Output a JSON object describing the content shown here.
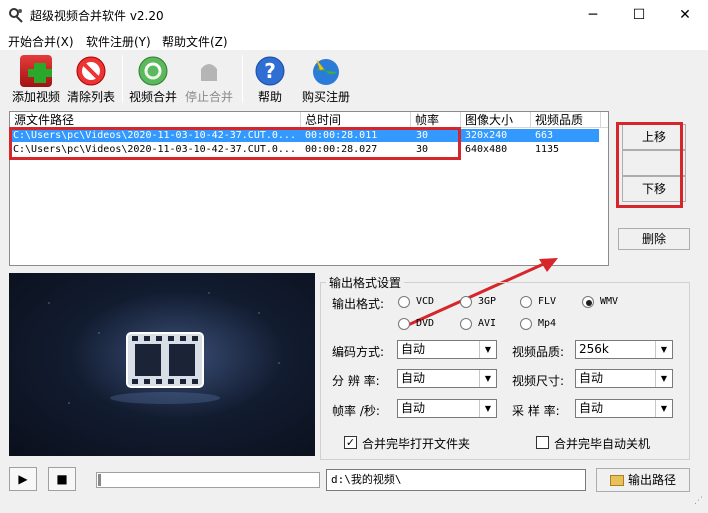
{
  "window": {
    "title": "超级视频合并软件 v2.20",
    "app_icon": "app-icon",
    "controls": [
      "─",
      "☐",
      "✕"
    ]
  },
  "menu": [
    "开始合并(X)",
    "软件注册(Y)",
    "帮助文件(Z)"
  ],
  "toolbar": {
    "add_video": "添加视频",
    "clear_list": "清除列表",
    "merge_video": "视频合并",
    "stop_merge": "停止合并",
    "help": "帮助",
    "buy_register": "购买注册"
  },
  "file_list": {
    "columns": [
      "源文件路径",
      "总时间",
      "帧率",
      "图像大小",
      "视频品质"
    ],
    "rows": [
      [
        "C:\\Users\\pc\\Videos\\2020-11-03-10-42-37.CUT.0...",
        "00:00:28.011",
        "30",
        "320x240",
        "663"
      ],
      [
        "C:\\Users\\pc\\Videos\\2020-11-03-10-42-37.CUT.0...",
        "00:00:28.027",
        "30",
        "640x480",
        "1135"
      ]
    ],
    "selected_row": 0
  },
  "side_buttons": {
    "move_up": "上移",
    "move_down": "下移",
    "delete": "删除"
  },
  "settings": {
    "group_title": "输出格式设置",
    "format_label": "输出格式:",
    "formats": [
      "VCD",
      "3GP",
      "FLV",
      "WMV",
      "DVD",
      "AVI",
      "Mp4"
    ],
    "selected_format": "WMV",
    "encoding_label": "编码方式:",
    "encoding_value": "自动",
    "resolution_label": "分 辨 率:",
    "resolution_value": "自动",
    "framerate_label": "帧率 /秒:",
    "framerate_value": "自动",
    "quality_label": "视频品质:",
    "quality_value": "256k",
    "size_label": "视频尺寸:",
    "size_value": "自动",
    "samplerate_label": "采 样 率:",
    "samplerate_value": "自动",
    "open_folder_label": "合并完毕打开文件夹",
    "open_folder_checked": true,
    "shutdown_label": "合并完毕自动关机",
    "shutdown_checked": false
  },
  "bottom": {
    "play": "▶",
    "stop": "■",
    "output_path": "d:\\我的视频\\",
    "output_button": "输出路径"
  },
  "colors": {
    "highlight": "#3399ff",
    "annotation_red": "#d7262b"
  }
}
